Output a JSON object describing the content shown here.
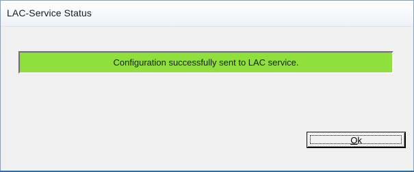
{
  "window": {
    "title": "LAC-Service Status"
  },
  "status": {
    "message": "Configuration successfully sent to LAC service.",
    "color": "#8fe03c"
  },
  "buttons": {
    "ok_label": "Ok"
  }
}
